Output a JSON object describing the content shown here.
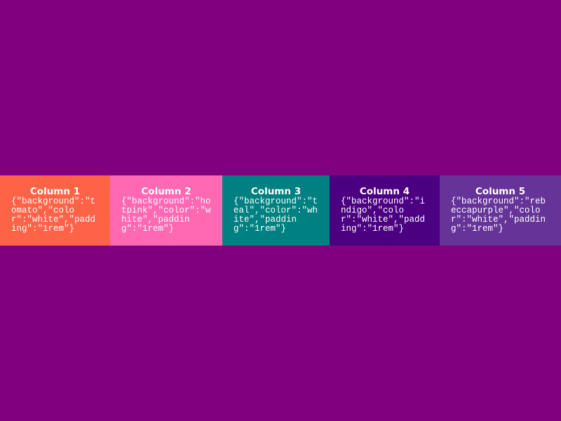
{
  "page": {
    "background": "#800080"
  },
  "columns": [
    {
      "title": "Column 1",
      "code": "{\"background\":\"tomato\",\"color\":\"white\",\"padding\":\"1rem\"}",
      "background": "#ff6347"
    },
    {
      "title": "Column 2",
      "code": "{\"background\":\"hotpink\",\"color\":\"white\",\"padding\":\"1rem\"}",
      "background": "#ff69b4"
    },
    {
      "title": "Column 3",
      "code": "{\"background\":\"teal\",\"color\":\"white\",\"padding\":\"1rem\"}",
      "background": "#008080"
    },
    {
      "title": "Column 4",
      "code": "{\"background\":\"indigo\",\"color\":\"white\",\"padding\":\"1rem\"}",
      "background": "#4b0082"
    },
    {
      "title": "Column 5",
      "code": "{\"background\":\"rebeccapurple\",\"color\":\"white\",\"padding\":\"1rem\"}",
      "background": "#663399"
    }
  ]
}
